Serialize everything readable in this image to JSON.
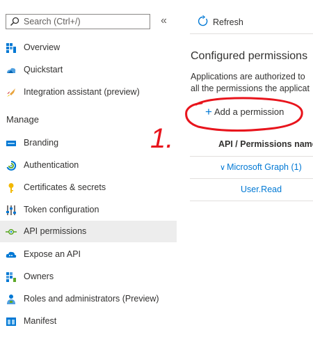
{
  "search": {
    "placeholder": "Search (Ctrl+/)"
  },
  "collapse_glyph": "«",
  "nav": {
    "items_top": [
      {
        "label": "Overview",
        "icon": "overview-icon"
      },
      {
        "label": "Quickstart",
        "icon": "quickstart-icon"
      },
      {
        "label": "Integration assistant (preview)",
        "icon": "rocket-icon"
      }
    ],
    "section_manage": "Manage",
    "items_manage": [
      {
        "label": "Branding",
        "icon": "branding-icon"
      },
      {
        "label": "Authentication",
        "icon": "authentication-icon"
      },
      {
        "label": "Certificates & secrets",
        "icon": "key-icon"
      },
      {
        "label": "Token configuration",
        "icon": "token-config-icon"
      },
      {
        "label": "API permissions",
        "icon": "api-permissions-icon",
        "selected": true
      },
      {
        "label": "Expose an API",
        "icon": "cloud-icon"
      },
      {
        "label": "Owners",
        "icon": "owners-icon"
      },
      {
        "label": "Roles and administrators (Preview)",
        "icon": "roles-icon"
      },
      {
        "label": "Manifest",
        "icon": "manifest-icon"
      }
    ]
  },
  "toolbar": {
    "refresh_label": "Refresh"
  },
  "main": {
    "heading": "Configured permissions",
    "desc_line1": "Applications are authorized to",
    "desc_line2": "all the permissions the applicat",
    "add_permission_label": "Add a permission",
    "add_plus": "+",
    "table_header": "API / Permissions name",
    "group_label": "Microsoft Graph (1)",
    "group_chevron": "∨",
    "permission": "User.Read"
  },
  "annotation": {
    "text": "1."
  },
  "colors": {
    "accent": "#0078d4",
    "annotation": "#e8141c",
    "selected_bg": "#ededed"
  }
}
